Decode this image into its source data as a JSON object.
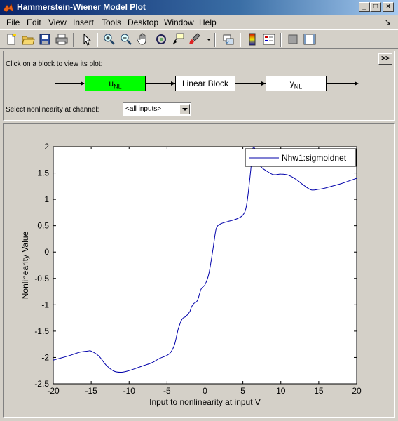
{
  "window": {
    "title": "Hammerstein-Wiener Model Plot"
  },
  "menu": [
    "File",
    "Edit",
    "View",
    "Insert",
    "Tools",
    "Desktop",
    "Window",
    "Help"
  ],
  "menu_dock_arrow": "↘",
  "toolbar": {
    "icons": [
      "new-figure",
      "open-file",
      "save",
      "print",
      "select-pointer",
      "zoom-in",
      "zoom-out",
      "pan-hand",
      "rotate-3d",
      "data-cursor",
      "brush",
      "brush-dropdown",
      "link-plot",
      "colorbar",
      "legend",
      "hide-plot-tools",
      "show-plot-tools"
    ]
  },
  "top_panel": {
    "instruction": "Click on a block to view its plot:",
    "expand_label": ">>",
    "blocks": {
      "input_nl": {
        "main": "u",
        "sub": "NL",
        "color": "#00ff00"
      },
      "linear": {
        "label": "Linear Block"
      },
      "output_nl": {
        "main": "y",
        "sub": "NL"
      }
    },
    "select_label": "Select nonlinearity at channel:",
    "select_value": "<all inputs>"
  },
  "chart_data": {
    "type": "line",
    "xlabel": "Input to nonlinearity at input V",
    "ylabel": "Nonlinearity Value",
    "xlim": [
      -20,
      20
    ],
    "ylim": [
      -2.5,
      2
    ],
    "xticks": [
      -20,
      -15,
      -10,
      -5,
      0,
      5,
      10,
      15,
      20
    ],
    "yticks": [
      -2.5,
      -2,
      -1.5,
      -1,
      -0.5,
      0,
      0.5,
      1,
      1.5,
      2
    ],
    "grid": false,
    "legend_position": "top-right",
    "series": [
      {
        "name": "Nhw1:sigmoidnet",
        "color": "#0000aa",
        "x": [
          -20,
          -18,
          -16.5,
          -15.5,
          -15,
          -14,
          -13,
          -12,
          -11,
          -10,
          -9,
          -8,
          -7,
          -6,
          -5,
          -4.5,
          -4,
          -3.5,
          -3,
          -2.5,
          -2,
          -1.8,
          -1.5,
          -1,
          -0.5,
          0,
          0.5,
          1,
          1.2,
          1.5,
          2,
          3,
          4,
          5,
          5.5,
          6,
          6.3,
          6.6,
          7,
          7.5,
          8,
          9,
          10,
          11,
          12,
          13,
          14,
          15,
          16,
          17,
          18,
          19,
          20
        ],
        "y": [
          -2.05,
          -1.97,
          -1.9,
          -1.88,
          -1.88,
          -1.97,
          -2.15,
          -2.26,
          -2.28,
          -2.25,
          -2.2,
          -2.15,
          -2.1,
          -2.02,
          -1.96,
          -1.9,
          -1.75,
          -1.45,
          -1.27,
          -1.22,
          -1.13,
          -1.05,
          -0.98,
          -0.92,
          -0.7,
          -0.62,
          -0.42,
          0.0,
          0.2,
          0.45,
          0.53,
          0.58,
          0.62,
          0.7,
          0.9,
          1.5,
          1.95,
          1.95,
          1.7,
          1.6,
          1.55,
          1.47,
          1.48,
          1.46,
          1.38,
          1.27,
          1.18,
          1.19,
          1.22,
          1.26,
          1.3,
          1.35,
          1.4
        ]
      }
    ]
  }
}
